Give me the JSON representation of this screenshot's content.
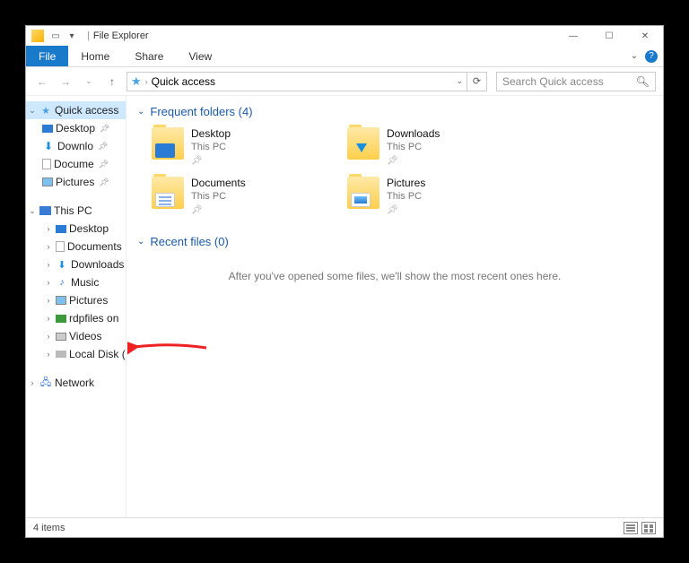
{
  "window": {
    "title": "File Explorer"
  },
  "ribbon": {
    "file": "File",
    "tabs": [
      "Home",
      "Share",
      "View"
    ]
  },
  "nav": {
    "location": "Quick access",
    "search_placeholder": "Search Quick access"
  },
  "sidebar": {
    "quickAccess": {
      "label": "Quick access",
      "items": [
        {
          "label": "Desktop"
        },
        {
          "label": "Downlo"
        },
        {
          "label": "Docume"
        },
        {
          "label": "Pictures"
        }
      ]
    },
    "thisPC": {
      "label": "This PC",
      "items": [
        {
          "label": "Desktop"
        },
        {
          "label": "Documents"
        },
        {
          "label": "Downloads"
        },
        {
          "label": "Music"
        },
        {
          "label": "Pictures"
        },
        {
          "label": "rdpfiles on"
        },
        {
          "label": "Videos"
        },
        {
          "label": "Local Disk ("
        }
      ]
    },
    "network": {
      "label": "Network"
    }
  },
  "sections": {
    "frequent": {
      "heading": "Frequent folders (4)",
      "folders": [
        {
          "name": "Desktop",
          "loc": "This PC",
          "iconOverlay": "desktop"
        },
        {
          "name": "Downloads",
          "loc": "This PC",
          "iconOverlay": "dl"
        },
        {
          "name": "Documents",
          "loc": "This PC",
          "iconOverlay": "doc"
        },
        {
          "name": "Pictures",
          "loc": "This PC",
          "iconOverlay": "pic"
        }
      ]
    },
    "recent": {
      "heading": "Recent files (0)",
      "empty_msg": "After you've opened some files, we'll show the most recent ones here."
    }
  },
  "status": {
    "text": "4 items"
  }
}
